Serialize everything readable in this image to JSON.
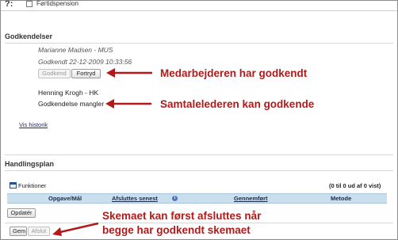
{
  "top": {
    "label_prefix": "?:",
    "checkbox_label": "Førtidspension"
  },
  "approvals": {
    "title": "Godkendelser",
    "employee_name": "Marianne Madsen - MUS",
    "employee_approved": "Godkendt 22-12-2009 10:33:56",
    "approve_button": "Godkend",
    "regret_button": "Fortryd",
    "manager_name": "Henning Krogh - HK",
    "manager_status": "Godkendelse mangler",
    "history_link": "Vis historik"
  },
  "annotations": {
    "employee": "Medarbejderen har godkendt",
    "manager": "Samtalelederen kan godkende",
    "footer_line1": "Skemaet kan først afsluttes når",
    "footer_line2": "begge har godkendt skemaet",
    "color": "#b21a1a"
  },
  "action_plan": {
    "title": "Handlingsplan",
    "functions_label": "Funktioner",
    "count_text": "(0 til 0 ud af 0 vist)",
    "columns": [
      "Opgave/Mål",
      "Afsluttes senest",
      "Gennemført",
      "Metode"
    ],
    "update_button": "Opdatér"
  },
  "footer": {
    "save_button": "Gem",
    "finish_button": "Afslut"
  },
  "icons": {
    "info": "info-icon",
    "functions": "functions-icon",
    "arrow": "red-arrow-icon"
  },
  "colors": {
    "table_header_bg": "#c9dfee",
    "link": "#1a2a8a",
    "annotation": "#b21a1a"
  }
}
